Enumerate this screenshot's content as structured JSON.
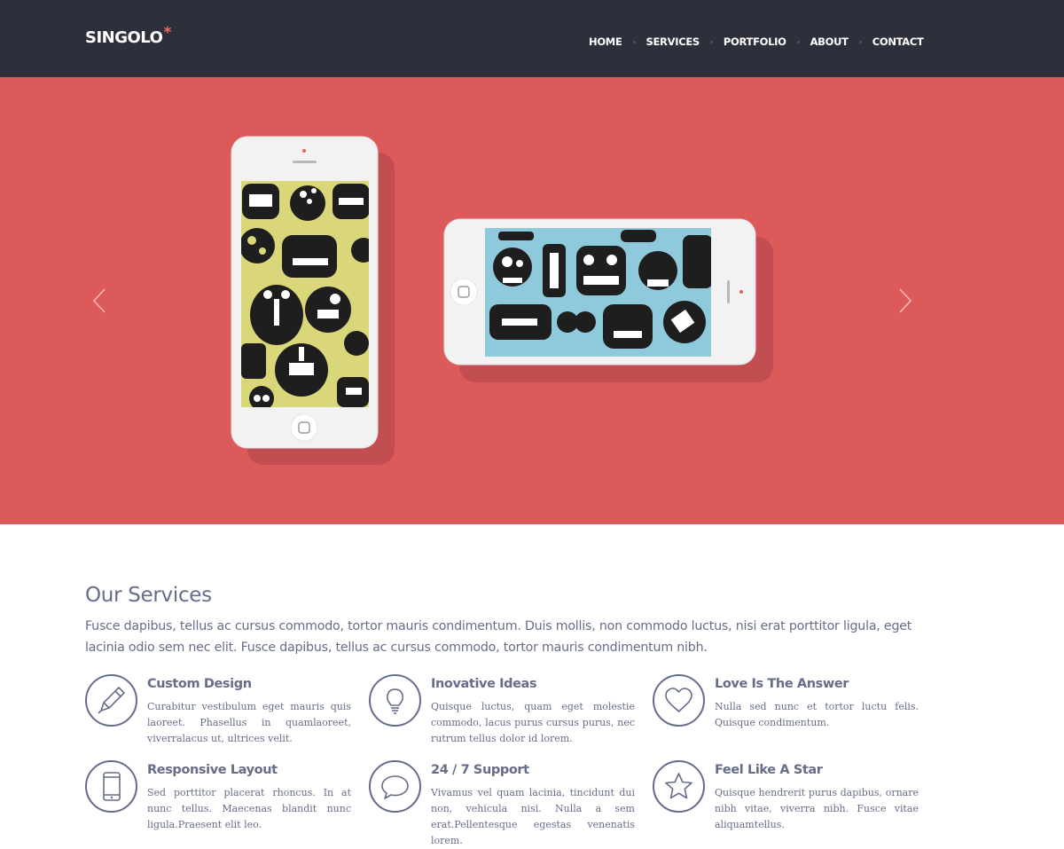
{
  "header": {
    "logo": "SINGOLO",
    "logo_mark": "*",
    "nav": [
      "HOME",
      "SERVICES",
      "PORTFOLIO",
      "ABOUT",
      "CONTACT"
    ]
  },
  "slider": {
    "prev_icon": "chevron-left-icon",
    "next_icon": "chevron-right-icon",
    "background": "#dd5a5a"
  },
  "services": {
    "title": "Our Services",
    "description": "Fusce dapibus, tellus ac cursus commodo, tortor mauris condimentum. Duis mollis, non commodo luctus, nisi erat porttitor ligula, eget lacinia odio sem nec elit. Fusce dapibus, tellus ac cursus commodo, tortor mauris condimentum nibh.",
    "items": [
      {
        "title": "Custom Design",
        "text": "Curabitur vestibulum eget mauris quis laoreet. Phasellus in quamlaoreet, viverralacus ut, ultrices velit.",
        "icon": "pencil-icon"
      },
      {
        "title": "Inovative Ideas",
        "text": "Quisque luctus, quam eget molestie commodo, lacus purus cursus purus, nec rutrum tellus dolor id lorem.",
        "icon": "lightbulb-icon"
      },
      {
        "title": "Love Is The Answer",
        "text": "Nulla sed nunc et tortor luctu felis. Quisque condimentum.",
        "icon": "heart-icon"
      },
      {
        "title": "Responsive Layout",
        "text": "Sed porttitor placerat rhoncus. In at nunc tellus. Maecenas blandit nunc ligula.Praesent elit leo.",
        "icon": "smartphone-icon"
      },
      {
        "title": "24 / 7 Support",
        "text": "Vivamus vel quam lacinia, tincidunt dui non, vehicula nisi. Nulla a sem erat.Pellentesque egestas venenatis lorem.",
        "icon": "chat-bubble-icon"
      },
      {
        "title": "Feel Like A Star",
        "text": "Quisque hendrerit purus dapibus, ornare nibh vitae, viverra nibh. Fusce vitae aliquamtellus.",
        "icon": "star-icon"
      }
    ]
  }
}
